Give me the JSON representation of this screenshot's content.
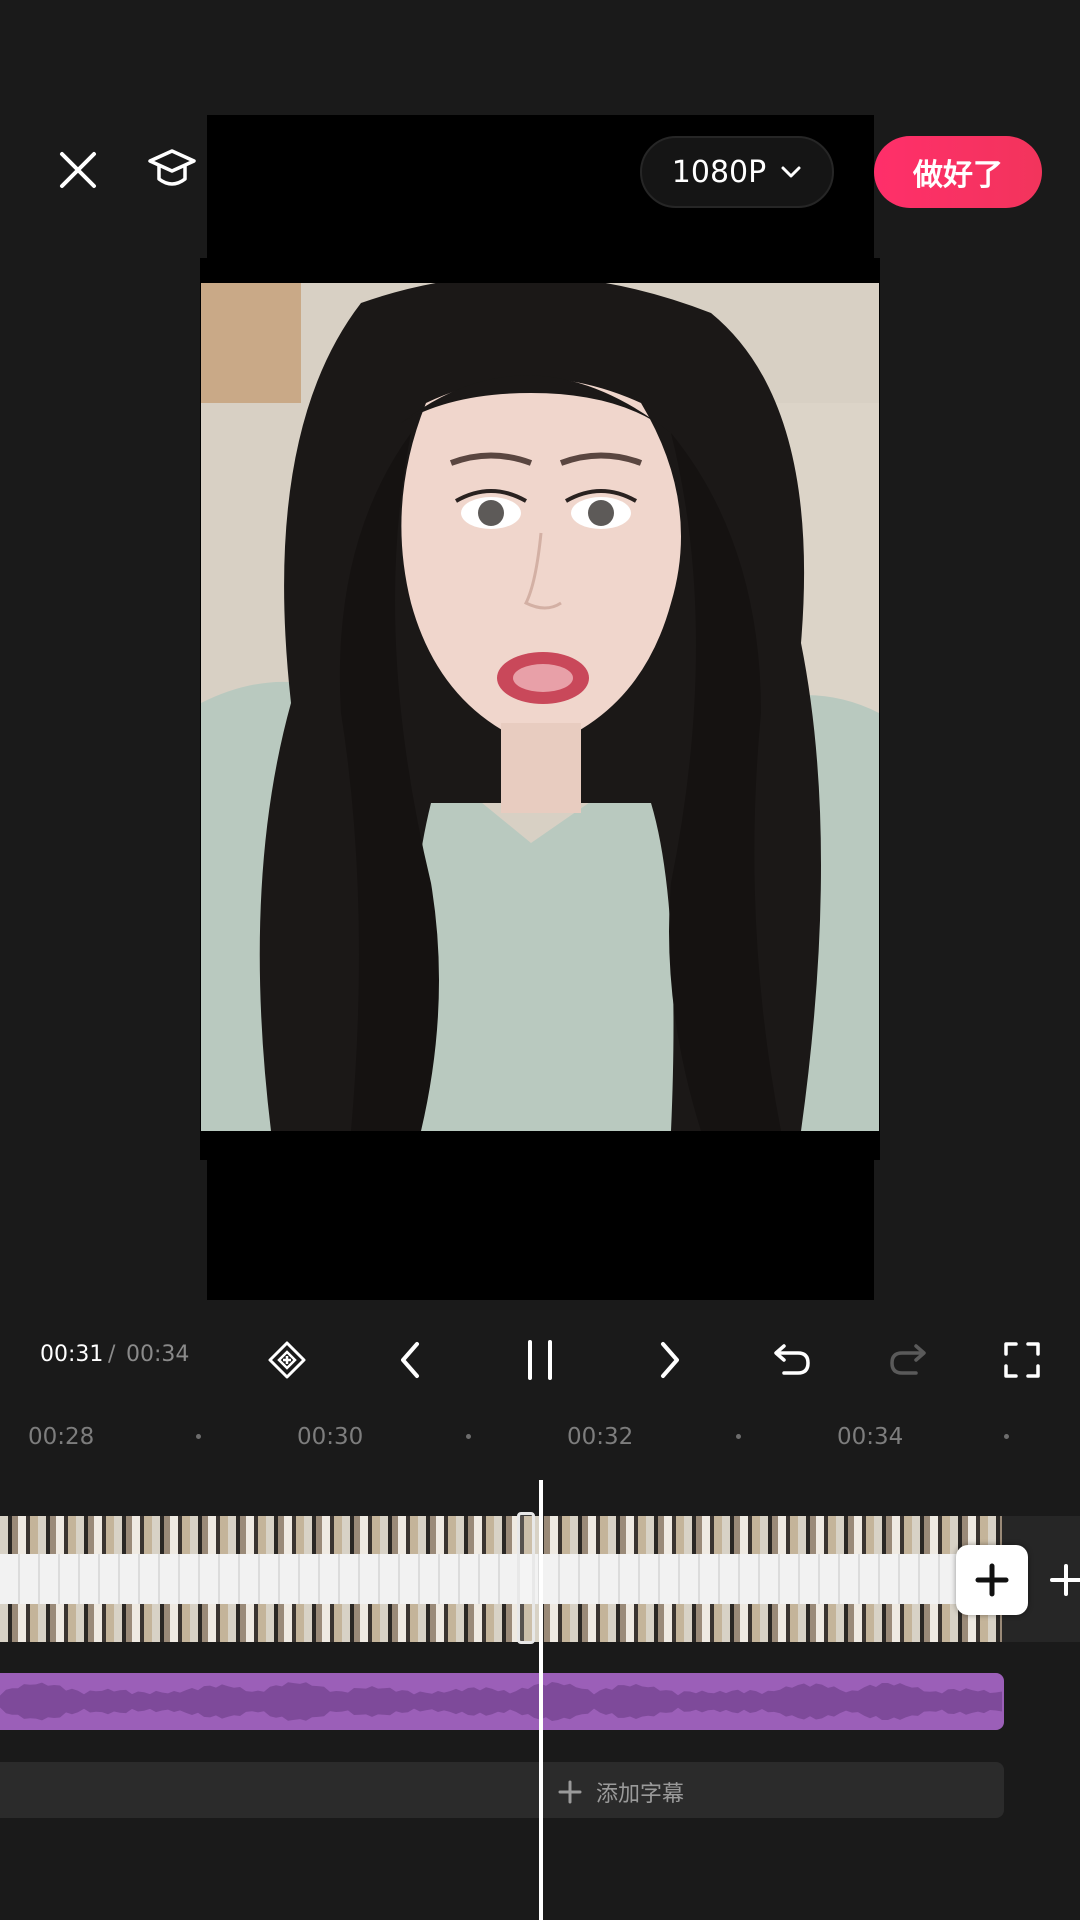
{
  "header": {
    "resolution_label": "1080P",
    "done_label": "做好了"
  },
  "playback": {
    "current_time": "00:31",
    "separator": "/",
    "total_time": "00:34"
  },
  "timeline": {
    "ruler_labels": [
      "00:28",
      "00:30",
      "00:32",
      "00:34"
    ],
    "add_subtitle_label": "添加字幕"
  },
  "colors": {
    "accent": "#f2345c",
    "audio_track": "#9b5fb8",
    "background": "#1a1a1a"
  },
  "icons": {
    "close": "close-icon",
    "tutorial": "graduation-cap-icon",
    "keyframe": "keyframe-diamond-icon",
    "prev": "chevron-left-icon",
    "pause": "pause-icon",
    "next": "chevron-right-icon",
    "undo": "undo-icon",
    "redo": "redo-icon",
    "fullscreen": "fullscreen-icon"
  }
}
